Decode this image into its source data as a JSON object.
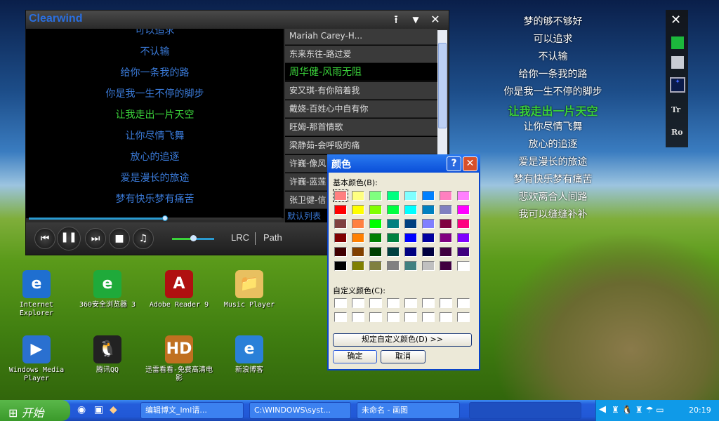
{
  "player": {
    "title": "Clearwind",
    "buttons": {
      "pin": "⭱",
      "menu": "▼",
      "close": "✕"
    },
    "lyrics": {
      "partial_top": "可以追求",
      "lines": [
        "不认输",
        "给你一条我的路",
        "你是我一生不停的脚步",
        "让我走出一片天空",
        "让你尽情飞舞",
        "放心的追逐",
        "爱是漫长的旅途",
        "梦有快乐梦有痛苦"
      ],
      "current_index": 3
    },
    "playlist": {
      "items": [
        "Mariah Carey-H...",
        "东来东往-路过爱",
        "周华健-风雨无阻",
        "安又琪-有你陪着我",
        "戴娆-百姓心中自有你",
        "旺姆-那首情歌",
        "梁静茹-会呼吸的痛",
        "许巍-像风",
        "许巍-蓝莲",
        "张卫健-信"
      ],
      "active_index": 2,
      "footer": "默认列表"
    },
    "progress_percent": 54,
    "volume_percent": 50,
    "controls": {
      "prev": "⏮",
      "pause": "❚❚",
      "next": "⏭",
      "stop": "■",
      "music": "♫",
      "lrc": "LRC",
      "path": "Path"
    }
  },
  "desktop_lyrics": {
    "lines": [
      "梦的够不够好",
      "可以追求",
      "不认输",
      "给你一条我的路",
      "你是我一生不停的脚步",
      "让我走出一片天空",
      "让你尽情飞舞",
      "放心的追逐",
      "爱是漫长的旅途",
      "梦有快乐梦有痛苦",
      "悲欢离合人间路",
      "我可以缝缝补补"
    ],
    "current_index": 5,
    "toolbar": {
      "close": "✕",
      "color1": "#1cb83c",
      "color2": "#c8ccd4",
      "tr": "Tr",
      "ro": "Ro"
    }
  },
  "color_dialog": {
    "title": "颜色",
    "help": "?",
    "close": "✕",
    "basic_label": "基本颜色(B):",
    "custom_label": "自定义颜色(C):",
    "define_button": "规定自定义颜色(D) >>",
    "ok": "确定",
    "cancel": "取消",
    "selected_index": 0,
    "basic_colors": [
      "#FF8080",
      "#FFFF80",
      "#80FF80",
      "#00FF80",
      "#80FFFF",
      "#0080FF",
      "#FF80C0",
      "#FF80FF",
      "#FF0000",
      "#FFFF00",
      "#80FF00",
      "#00FF40",
      "#00FFFF",
      "#0080C0",
      "#8080C0",
      "#FF00FF",
      "#804040",
      "#FF8040",
      "#00FF00",
      "#008080",
      "#004080",
      "#8080FF",
      "#800040",
      "#FF0080",
      "#800000",
      "#FF8000",
      "#008000",
      "#008040",
      "#0000FF",
      "#0000A0",
      "#800080",
      "#8000FF",
      "#400000",
      "#804000",
      "#004000",
      "#004040",
      "#000080",
      "#000040",
      "#400040",
      "#400080",
      "#000000",
      "#808000",
      "#808040",
      "#808080",
      "#408080",
      "#C0C0C0",
      "#400040",
      "#FFFFFF"
    ],
    "custom_colors": [
      "#FFFFFF",
      "#FFFFFF",
      "#FFFFFF",
      "#FFFFFF",
      "#FFFFFF",
      "#FFFFFF",
      "#FFFFFF",
      "#FFFFFF",
      "#FFFFFF",
      "#FFFFFF",
      "#FFFFFF",
      "#FFFFFF",
      "#FFFFFF",
      "#FFFFFF",
      "#FFFFFF",
      "#FFFFFF"
    ]
  },
  "desktop_icons": [
    {
      "label": "Internet Explorer",
      "glyph": "e",
      "color": "#1f6fd0"
    },
    {
      "label": "360安全浏览器 3",
      "glyph": "e",
      "color": "#1faa3a"
    },
    {
      "label": "Adobe Reader 9",
      "glyph": "A",
      "color": "#b01010"
    },
    {
      "label": "Music Player",
      "glyph": "📁",
      "color": "#e8c060"
    },
    {
      "label": "Windows Media Player",
      "glyph": "▶",
      "color": "#2a70d0"
    },
    {
      "label": "腾讯QQ",
      "glyph": "🐧",
      "color": "#222222"
    },
    {
      "label": "迅雷看看-免费高清电影",
      "glyph": "HD",
      "color": "#c07020"
    },
    {
      "label": "新浪博客",
      "glyph": "e",
      "color": "#2a80d8"
    }
  ],
  "taskbar": {
    "start": "开始",
    "tasks": [
      "编辑博文_lml请...",
      "C:\\WINDOWS\\syst...",
      "未命名 - 画图",
      ""
    ],
    "clock": "20:19"
  }
}
